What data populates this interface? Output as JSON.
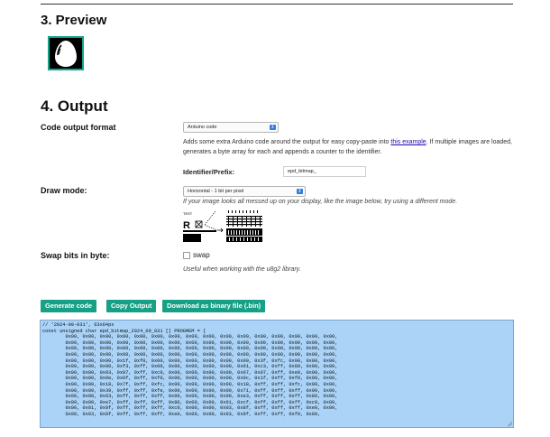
{
  "preview": {
    "heading": "3. Preview",
    "image_desc_icon": "egg-silhouette-icon"
  },
  "output": {
    "heading": "4. Output",
    "code_format": {
      "label": "Code output format",
      "selected": "Arduino code",
      "desc_before": "Adds some extra Arduino code around the output for easy copy-paste into ",
      "desc_link": "this example",
      "desc_after": ". If multiple images are loaded, generates a byte array for each and appends a counter to the identifier."
    },
    "identifier": {
      "label": "Identifier/Prefix:",
      "value": "epd_bitmap_"
    },
    "draw_mode": {
      "label": "Draw mode:",
      "selected": "Horizontal - 1 bit per pixel",
      "desc": "If your image looks all messed up on your display, like the image below, try using a different mode.",
      "sample_text": "TEST"
    },
    "swap_bits": {
      "label": "Swap bits in byte:",
      "checkbox_label": "swap",
      "checked": false,
      "desc": "Useful when working with the u8g2 library."
    },
    "buttons": {
      "generate": "Generate code",
      "copy": "Copy Output",
      "download": "Download as binary file (.bin)"
    },
    "code_lines": [
      "// '2024-09-031', 63x64px",
      "const unsigned char epd_bitmap_2024_09_031 [] PROGMEM = {",
      "\t0x00, 0x00, 0x00, 0x00, 0x00, 0x00, 0x00, 0x00, 0x00, 0x00, 0x00, 0x00, 0x00, 0x00, 0x00, 0x00,",
      "\t0x00, 0x00, 0x00, 0x00, 0x00, 0x00, 0x00, 0x00, 0x00, 0x00, 0x00, 0x00, 0x00, 0x00, 0x00, 0x00,",
      "\t0x00, 0x00, 0x00, 0x00, 0x00, 0x00, 0x00, 0x00, 0x00, 0x00, 0x00, 0x00, 0x00, 0x00, 0x00, 0x00,",
      "\t0x00, 0x00, 0x00, 0x00, 0x00, 0x00, 0x00, 0x00, 0x00, 0x00, 0x00, 0x00, 0x00, 0x00, 0x00, 0x00,",
      "\t0x00, 0x00, 0x00, 0x1f, 0xf0, 0x00, 0x00, 0x00, 0x00, 0x00, 0x00, 0x3f, 0xfc, 0x00, 0x00, 0x00,",
      "\t0x00, 0x00, 0x00, 0xf3, 0xff, 0x00, 0x00, 0x00, 0x00, 0x00, 0x01, 0xc3, 0xff, 0x80, 0x00, 0x00,",
      "\t0x00, 0x00, 0x03, 0x87, 0xff, 0xc0, 0x00, 0x00, 0x00, 0x00, 0x07, 0x07, 0xff, 0xe0, 0x00, 0x00,",
      "\t0x00, 0x00, 0x0e, 0x0f, 0xff, 0xf0, 0x00, 0x00, 0x00, 0x00, 0x0c, 0x1f, 0xff, 0xf8, 0x00, 0x00,",
      "\t0x00, 0x00, 0x18, 0x7f, 0xff, 0xfc, 0x00, 0x00, 0x00, 0x00, 0x18, 0xff, 0xff, 0xfc, 0x00, 0x00,",
      "\t0x00, 0x00, 0x39, 0xff, 0xff, 0xfe, 0x00, 0x00, 0x00, 0x00, 0x71, 0xff, 0xff, 0xff, 0x00, 0x00,",
      "\t0x00, 0x00, 0x63, 0xff, 0xff, 0xff, 0x00, 0x00, 0x00, 0x00, 0xe3, 0xff, 0xff, 0xff, 0x80, 0x00,",
      "\t0x00, 0x00, 0xe7, 0xff, 0xff, 0xff, 0x80, 0x00, 0x00, 0x01, 0xcf, 0xff, 0xff, 0xff, 0xc0, 0x00,",
      "\t0x00, 0x01, 0x8f, 0xff, 0xff, 0xff, 0xc0, 0x00, 0x00, 0x03, 0x8f, 0xff, 0xff, 0xff, 0xe0, 0x00,",
      "\t0x00, 0x03, 0x8f, 0xff, 0xff, 0xff, 0xe0, 0x00, 0x00, 0x03, 0x9f, 0xff, 0xff, 0xf0, 0x00,"
    ]
  }
}
